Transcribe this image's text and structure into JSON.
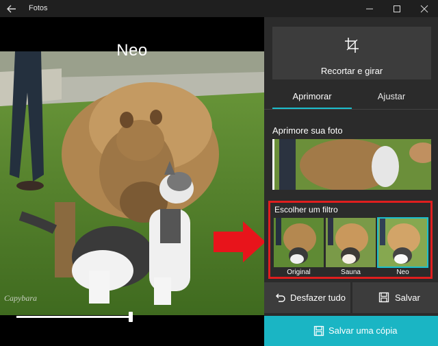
{
  "window": {
    "title": "Fotos"
  },
  "photo": {
    "filter_name": "Neo",
    "watermark": "Capybara"
  },
  "panel": {
    "crop_label": "Recortar e girar",
    "tabs": [
      {
        "label": "Aprimorar",
        "active": true
      },
      {
        "label": "Ajustar",
        "active": false
      }
    ],
    "enhance_title": "Aprimore sua foto",
    "filter_title": "Escolher um filtro",
    "filters": [
      {
        "label": "Original",
        "selected": false
      },
      {
        "label": "Sauna",
        "selected": false
      },
      {
        "label": "Neo",
        "selected": true
      }
    ],
    "undo_label": "Desfazer tudo",
    "save_label": "Salvar",
    "save_copy_label": "Salvar uma cópia"
  },
  "colors": {
    "accent": "#1bbfce",
    "highlight": "#e01e1e",
    "panel_bg": "#2b2b2b"
  }
}
